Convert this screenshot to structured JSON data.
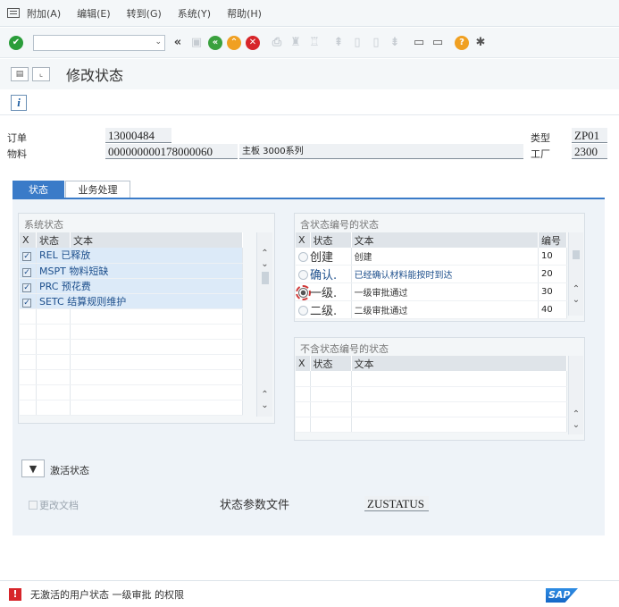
{
  "menu": {
    "items": [
      "附加(A)",
      "编辑(E)",
      "转到(G)",
      "系统(Y)",
      "帮助(H)"
    ]
  },
  "toolbar": {
    "command_value": ""
  },
  "title": "修改状态",
  "header": {
    "order_label": "订单",
    "order_value": "13000484",
    "material_label": "物料",
    "material_value": "000000000178000060",
    "material_desc": "主板 3000系列",
    "type_label": "类型",
    "type_value": "ZP01",
    "plant_label": "工厂",
    "plant_value": "2300"
  },
  "tabs": [
    "状态",
    "业务处理"
  ],
  "system_status": {
    "title": "系统状态",
    "columns": [
      "X",
      "状态",
      "文本"
    ],
    "rows": [
      {
        "checked": true,
        "status": "REL",
        "text": "已释放"
      },
      {
        "checked": true,
        "status": "MSPT",
        "text": "物料短缺"
      },
      {
        "checked": true,
        "status": "PRC",
        "text": "预花费"
      },
      {
        "checked": true,
        "status": "SETC",
        "text": "结算规则维护"
      }
    ]
  },
  "numbered_status": {
    "title": "含状态编号的状态",
    "columns": [
      "X",
      "状态",
      "文本",
      "编号"
    ],
    "rows": [
      {
        "selected": false,
        "status": "创建",
        "text": "创建",
        "number": "10"
      },
      {
        "selected": false,
        "status": "确认",
        "text": "已经确认材料能按时到达",
        "number": "20"
      },
      {
        "selected": true,
        "status": "一级",
        "text": "一级审批通过",
        "number": "30"
      },
      {
        "selected": false,
        "status": "二级",
        "text": "二级审批通过",
        "number": "40"
      }
    ]
  },
  "unnumbered_status": {
    "title": "不含状态编号的状态",
    "columns": [
      "X",
      "状态",
      "文本"
    ]
  },
  "activate_label": "激活状态",
  "change_docs_label": "更改文档",
  "profile_label": "状态参数文件",
  "profile_value": "ZUSTATUS",
  "status_message": "无激活的用户状态 一级审批 的权限",
  "sap_logo_text": "SAP",
  "colors": {
    "accent": "#3a7bc8",
    "error": "#d7252a",
    "ok": "#2a9d3a",
    "nav_green": "#3aa13e",
    "nav_orange": "#f0a022"
  }
}
